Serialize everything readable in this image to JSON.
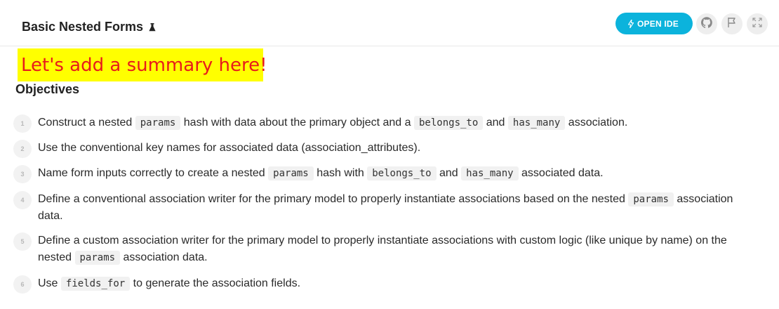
{
  "header": {
    "title": "Basic Nested Forms",
    "open_ide_label": "OPEN IDE",
    "accent_color": "#0bb3dc",
    "icons": [
      "flask-icon",
      "bolt-icon",
      "github-icon",
      "flag-icon",
      "expand-icon"
    ]
  },
  "annotation": {
    "text": "Let's add a summary here!",
    "bg_color": "#ffff00",
    "text_color": "#e81b1b"
  },
  "objectives": {
    "heading": "Objectives",
    "items": [
      {
        "number": "1",
        "t1": "Construct a nested",
        "c1": "params",
        "t2": "hash with data about the primary object and a",
        "c2": "belongs_to",
        "t3": "and",
        "c3": "has_many",
        "t4": "association."
      },
      {
        "number": "2",
        "t1": "Use the conventional key names for associated data (association_attributes)."
      },
      {
        "number": "3",
        "t1": "Name form inputs correctly to create a nested",
        "c1": "params",
        "t2": "hash with",
        "c2": "belongs_to",
        "t3": "and",
        "c3": "has_many",
        "t4": "associated data."
      },
      {
        "number": "4",
        "t1": "Define a conventional association writer for the primary model to properly instantiate associations based on the nested",
        "c1": "params",
        "t2": "association data."
      },
      {
        "number": "5",
        "t1": "Define a custom association writer for the primary model to properly instantiate associations with custom logic (like unique by name) on the nested",
        "c1": "params",
        "t2": "association data."
      },
      {
        "number": "6",
        "t1": "Use",
        "c1": "fields_for",
        "t2": "to generate the association fields."
      }
    ]
  }
}
